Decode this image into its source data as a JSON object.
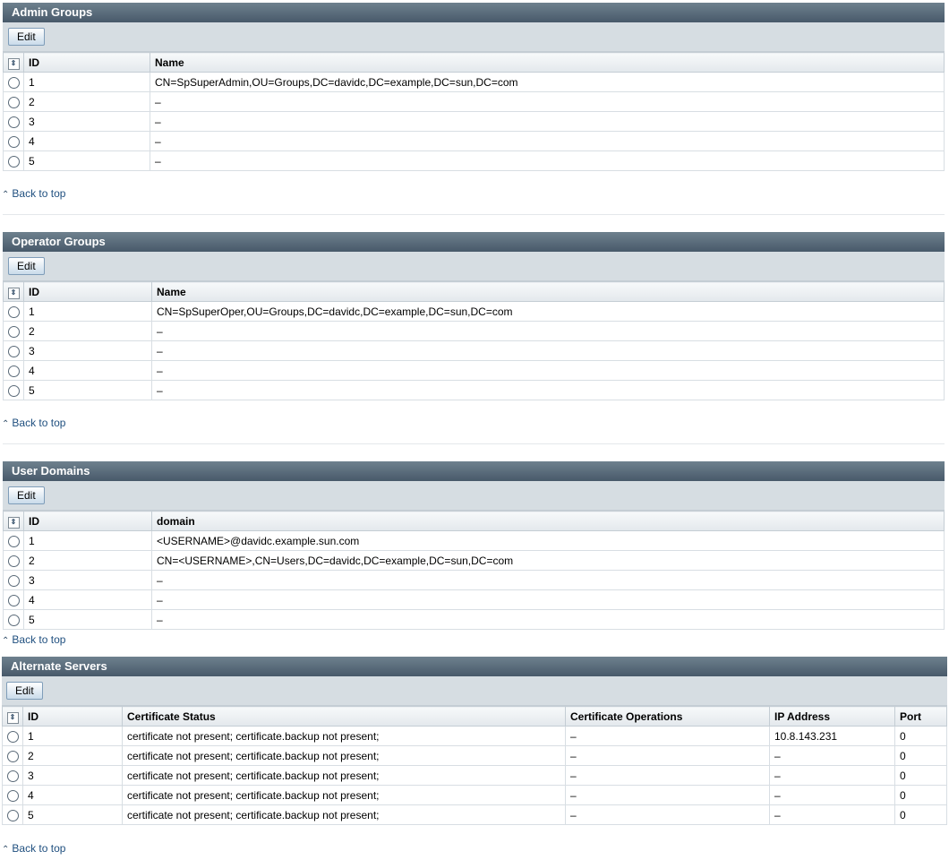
{
  "admin_groups": {
    "title": "Admin Groups",
    "edit_label": "Edit",
    "columns": [
      "ID",
      "Name"
    ],
    "rows": [
      {
        "id": "1",
        "name": "CN=SpSuperAdmin,OU=Groups,DC=davidc,DC=example,DC=sun,DC=com"
      },
      {
        "id": "2",
        "name": "–"
      },
      {
        "id": "3",
        "name": "–"
      },
      {
        "id": "4",
        "name": "–"
      },
      {
        "id": "5",
        "name": "–"
      }
    ]
  },
  "operator_groups": {
    "title": "Operator Groups",
    "edit_label": "Edit",
    "columns": [
      "ID",
      "Name"
    ],
    "rows": [
      {
        "id": "1",
        "name": "CN=SpSuperOper,OU=Groups,DC=davidc,DC=example,DC=sun,DC=com"
      },
      {
        "id": "2",
        "name": "–"
      },
      {
        "id": "3",
        "name": "–"
      },
      {
        "id": "4",
        "name": "–"
      },
      {
        "id": "5",
        "name": "–"
      }
    ]
  },
  "user_domains": {
    "title": "User Domains",
    "edit_label": "Edit",
    "columns": [
      "ID",
      "domain"
    ],
    "rows": [
      {
        "id": "1",
        "domain": "<USERNAME>@davidc.example.sun.com"
      },
      {
        "id": "2",
        "domain": "CN=<USERNAME>,CN=Users,DC=davidc,DC=example,DC=sun,DC=com"
      },
      {
        "id": "3",
        "domain": "–"
      },
      {
        "id": "4",
        "domain": "–"
      },
      {
        "id": "5",
        "domain": "–"
      }
    ]
  },
  "alternate_servers": {
    "title": "Alternate Servers",
    "edit_label": "Edit",
    "columns": [
      "ID",
      "Certificate Status",
      "Certificate Operations",
      "IP Address",
      "Port"
    ],
    "rows": [
      {
        "id": "1",
        "cert_status": "certificate not present; certificate.backup not present;",
        "cert_ops": "–",
        "ip": "10.8.143.231",
        "port": "0"
      },
      {
        "id": "2",
        "cert_status": "certificate not present; certificate.backup not present;",
        "cert_ops": "–",
        "ip": "–",
        "port": "0"
      },
      {
        "id": "3",
        "cert_status": "certificate not present; certificate.backup not present;",
        "cert_ops": "–",
        "ip": "–",
        "port": "0"
      },
      {
        "id": "4",
        "cert_status": "certificate not present; certificate.backup not present;",
        "cert_ops": "–",
        "ip": "–",
        "port": "0"
      },
      {
        "id": "5",
        "cert_status": "certificate not present; certificate.backup not present;",
        "cert_ops": "–",
        "ip": "–",
        "port": "0"
      }
    ]
  },
  "back_to_top_label": "Back to top",
  "icons": {
    "select_all": "select-all-icon",
    "back_to_top": "double-chevron-up-icon"
  },
  "colors": {
    "title_bar": "#48596a",
    "toolbar": "#d6dde2",
    "link": "#1f4f7f"
  }
}
